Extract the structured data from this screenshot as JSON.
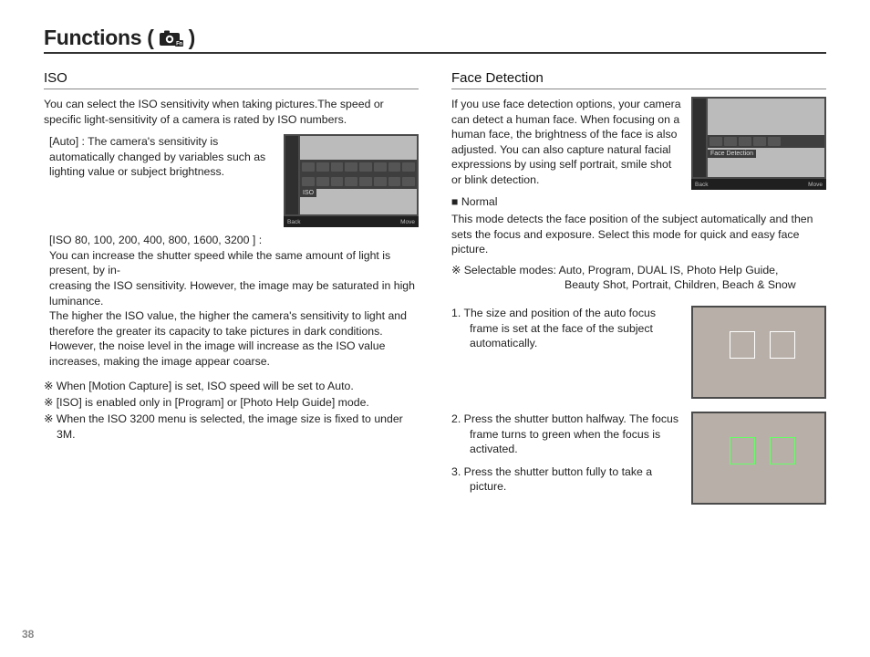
{
  "title_prefix": "Functions (",
  "title_suffix": ")",
  "page_number": "38",
  "iso": {
    "heading": "ISO",
    "intro": "You can select the ISO sensitivity when taking pictures.The speed or specific light-sensitivity of a camera is rated by ISO numbers.",
    "auto_label": "[Auto] :",
    "auto_body": "The camera's sensitivity is automatically changed by variables such as lighting value or subject brightness.",
    "list_head": "[ISO 80, 100, 200, 400, 800, 1600, 3200 ] :",
    "list_body1": "You can increase the shutter speed while the same amount of light is present, by in-",
    "list_body2": "creasing the ISO sensitivity. However, the image may be saturated in high luminance.",
    "list_body3": "The higher the ISO value, the higher the camera's sensitivity to light and therefore the greater its capacity to take pictures in dark conditions. However, the noise level in the image will increase as the ISO value increases, making the image appear coarse.",
    "note1": "※ When [Motion Capture] is set, ISO speed will be set to Auto.",
    "note2": "※ [ISO] is enabled only in [Program] or [Photo Help Guide] mode.",
    "note3": "※ When the ISO 3200 menu is selected, the image size is fixed to under 3M.",
    "shot_label": "ISO",
    "shot_back": "Back",
    "shot_move": "Move"
  },
  "fd": {
    "heading": "Face Detection",
    "intro": "If you use face detection options, your camera can detect a human face. When focusing on a human face, the brightness of the face is also adjusted. You can also capture natural facial expressions by using self portrait, smile shot or blink detection.",
    "normal_head": "■ Normal",
    "normal_body": "This mode detects the face position of the subject automatically and then sets the focus and exposure. Select this mode for quick and easy face picture.",
    "selectable": "※ Selectable modes: Auto, Program, DUAL IS, Photo Help Guide,",
    "selectable2": "Beauty Shot, Portrait, Children, Beach & Snow",
    "step1": "1. The size and position of the auto focus frame is set at the face of the subject automatically.",
    "step2": "2. Press the shutter button halfway. The focus frame turns to green when the focus is activated.",
    "step3": "3. Press the shutter button fully to take a picture.",
    "shot_label": "Face Detection",
    "shot_back": "Back",
    "shot_move": "Move"
  }
}
